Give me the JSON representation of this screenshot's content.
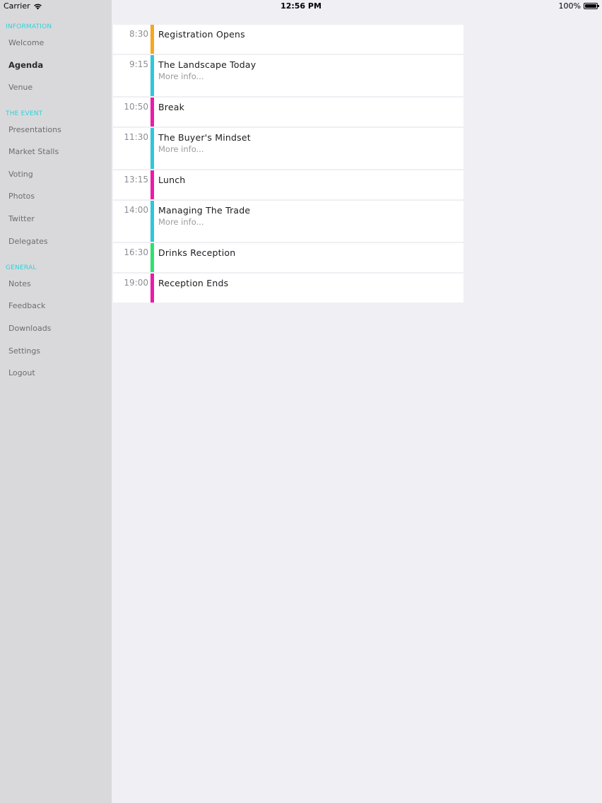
{
  "status_bar": {
    "carrier": "Carrier",
    "time": "12:56 PM",
    "battery": "100%"
  },
  "colors": {
    "accent": "#2ed3d6",
    "orange": "#f5a623",
    "cyan": "#2ec7d8",
    "magenta": "#ec1aa8",
    "green": "#2fe06e"
  },
  "sidebar": {
    "sections": [
      {
        "header": "INFORMATION",
        "items": [
          "Welcome",
          "Agenda",
          "Venue"
        ]
      },
      {
        "header": "THE EVENT",
        "items": [
          "Presentations",
          "Market Stalls",
          "Voting",
          "Photos",
          "Twitter",
          "Delegates"
        ]
      },
      {
        "header": "GENERAL",
        "items": [
          "Notes",
          "Feedback",
          "Downloads",
          "Settings",
          "Logout"
        ]
      }
    ],
    "active_item": "Agenda"
  },
  "agenda": [
    {
      "time": "8:30",
      "title": "Registration Opens",
      "more": "",
      "color": "#f5a623"
    },
    {
      "time": "9:15",
      "title": "The Landscape Today",
      "more": "More info...",
      "color": "#2ec7d8"
    },
    {
      "time": "10:50",
      "title": "Break",
      "more": "",
      "color": "#ec1aa8"
    },
    {
      "time": "11:30",
      "title": "The Buyer's Mindset",
      "more": "More info...",
      "color": "#2ec7d8"
    },
    {
      "time": "13:15",
      "title": "Lunch",
      "more": "",
      "color": "#ec1aa8"
    },
    {
      "time": "14:00",
      "title": "Managing The Trade",
      "more": "More info...",
      "color": "#2ec7d8"
    },
    {
      "time": "16:30",
      "title": "Drinks Reception",
      "more": "",
      "color": "#2fe06e"
    },
    {
      "time": "19:00",
      "title": "Reception Ends",
      "more": "",
      "color": "#ec1aa8"
    }
  ]
}
